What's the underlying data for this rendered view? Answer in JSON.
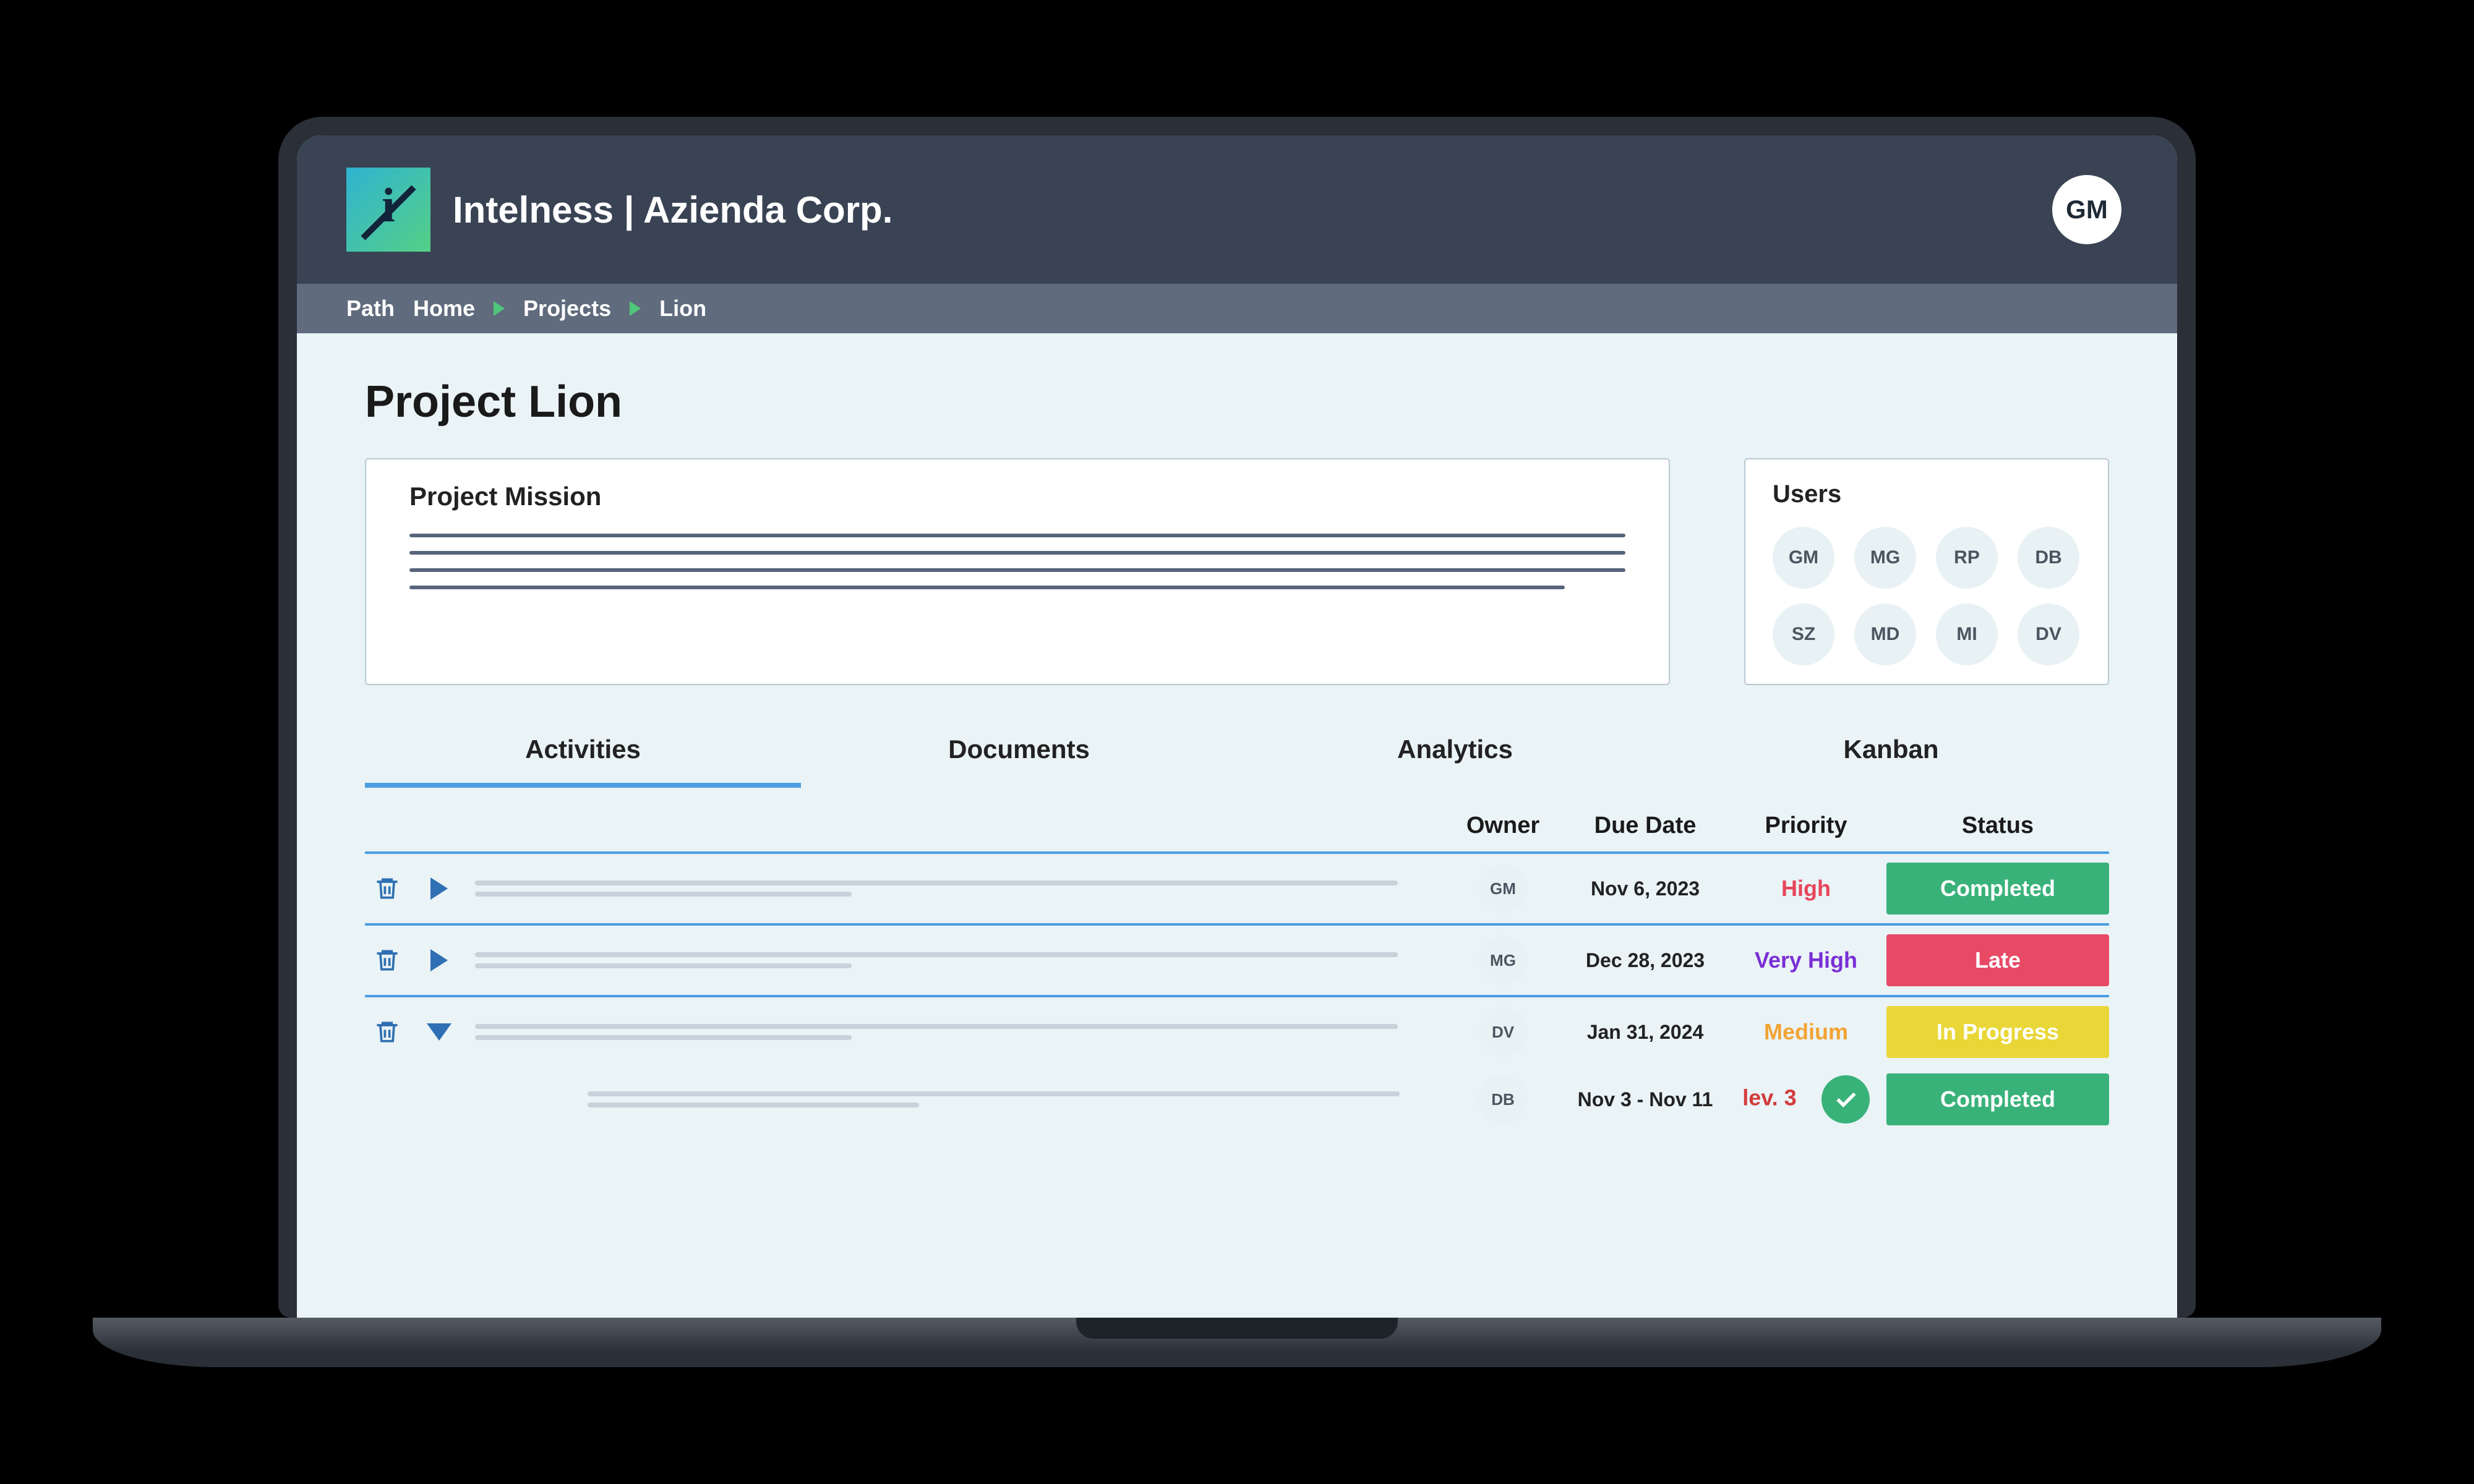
{
  "header": {
    "title": "Intelness | Azienda Corp.",
    "avatar": "GM"
  },
  "breadcrumb": {
    "label": "Path",
    "items": [
      "Home",
      "Projects",
      "Lion"
    ]
  },
  "page": {
    "title": "Project Lion"
  },
  "mission": {
    "title": "Project Mission"
  },
  "users": {
    "title": "Users",
    "list": [
      "GM",
      "MG",
      "RP",
      "DB",
      "SZ",
      "MD",
      "MI",
      "DV"
    ]
  },
  "tabs": {
    "items": [
      "Activities",
      "Documents",
      "Analytics",
      "Kanban"
    ],
    "active": 0
  },
  "table": {
    "headers": {
      "owner": "Owner",
      "due": "Due Date",
      "priority": "Priority",
      "status": "Status"
    },
    "rows": [
      {
        "owner": "GM",
        "due": "Nov 6, 2023",
        "priority": "High",
        "priority_cls": "p-high",
        "status": "Completed",
        "status_cls": "st-completed",
        "expanded": false
      },
      {
        "owner": "MG",
        "due": "Dec 28, 2023",
        "priority": "Very High",
        "priority_cls": "p-vhigh",
        "status": "Late",
        "status_cls": "st-late",
        "expanded": false
      },
      {
        "owner": "DV",
        "due": "Jan 31, 2024",
        "priority": "Medium",
        "priority_cls": "p-med",
        "status": "In Progress",
        "status_cls": "st-progress",
        "expanded": true
      }
    ],
    "subrow": {
      "owner": "DB",
      "due": "Nov 3 - Nov 11",
      "priority": "lev. 3",
      "status": "Completed"
    }
  }
}
